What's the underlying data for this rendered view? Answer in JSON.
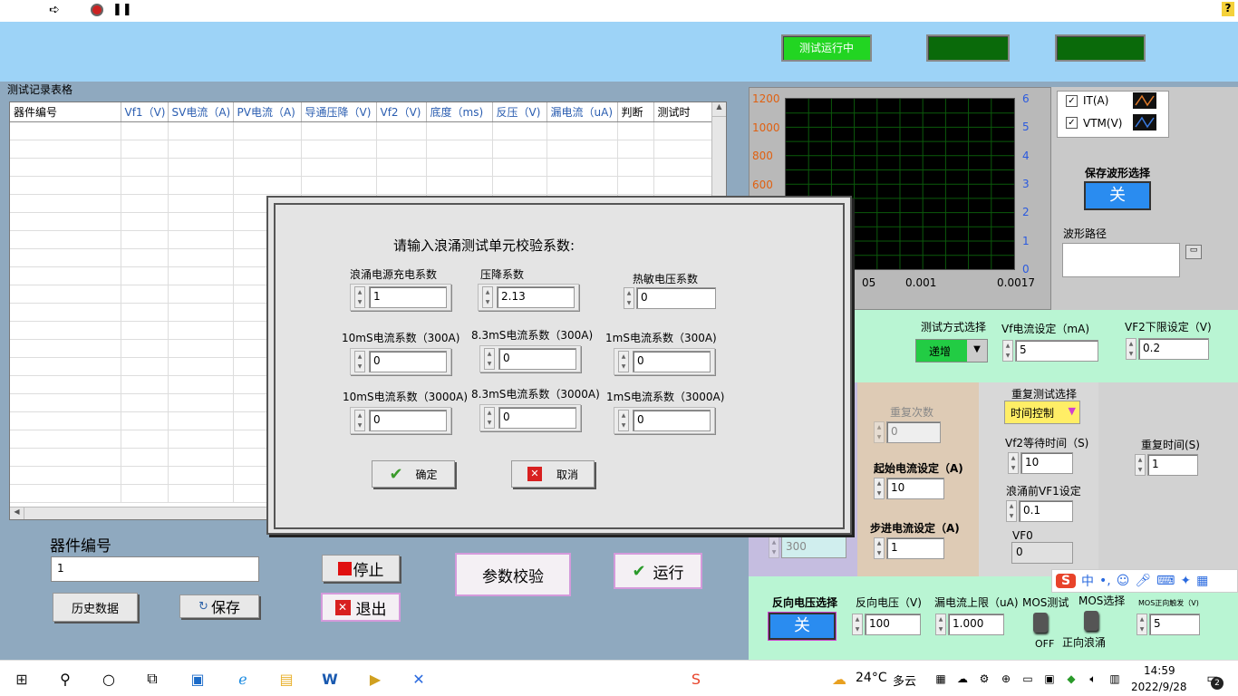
{
  "toolbar": {
    "run_icon": "run-arrow-icon",
    "abort_icon": "abort-icon",
    "pause_icon": "pause-icon",
    "help": "?"
  },
  "banner": {
    "status_indicator": "测试运行中",
    "indicator2": "",
    "indicator3": ""
  },
  "table": {
    "title": "测试记录表格",
    "columns": [
      "器件编号",
      "Vf1（V)",
      "SV电流（A)",
      "PV电流（A)",
      "导通压降（V)",
      "Vf2（V)",
      "底度（ms)",
      "反压（V)",
      "漏电流（uA)",
      "判断",
      "测试时"
    ]
  },
  "bottom_left": {
    "device_label": "器件编号",
    "device_value": "1",
    "history_button": "历史数据",
    "save_button": "保存",
    "stop_button": "停止",
    "exit_button": "退出",
    "verify_button": "参数校验",
    "run_button": "运行"
  },
  "chart": {
    "y_left_ticks": [
      "1200",
      "1000",
      "800",
      "600"
    ],
    "y_right_ticks": [
      "6",
      "5",
      "4",
      "3",
      "2",
      "1",
      "0"
    ],
    "x_ticks": [
      "05",
      "0.001",
      "0.0017"
    ]
  },
  "legend": {
    "items": [
      {
        "label": "IT(A)",
        "checked": true
      },
      {
        "label": "VTM(V)",
        "checked": true
      }
    ]
  },
  "waveform": {
    "save_label": "保存波形选择",
    "save_value": "关",
    "path_label": "波形路径",
    "path_value": ""
  },
  "mint": {
    "mode_label": "测试方式选择",
    "mode_value": "递增",
    "vf_current_label": "Vf电流设定（mA)",
    "vf_current_value": "5",
    "vf2_low_label": "VF2下限设定（V)",
    "vf2_low_value": "0.2"
  },
  "middle": {
    "repeat_count_label": "重复次数",
    "repeat_count_value": "0",
    "lav_value": "300",
    "start_current_label": "起始电流设定（A)",
    "start_current_value": "10",
    "step_current_label": "步进电流设定（A)",
    "step_current_value": "1",
    "repeat_select_label": "重复测试选择",
    "repeat_select_value": "时间控制",
    "vf2_wait_label": "Vf2等待时间（S)",
    "vf2_wait_value": "10",
    "pre_vf1_label": "浪涌前VF1设定",
    "pre_vf1_value": "0.1",
    "vf0_label": "VF0",
    "vf0_value": "0",
    "repeat_time_label": "重复时间(S)",
    "repeat_time_value": "1"
  },
  "bottom_right": {
    "rev_select_label": "反向电压选择",
    "rev_select_value": "关",
    "rev_voltage_label": "反向电压（V)",
    "rev_voltage_value": "100",
    "leak_limit_label": "漏电流上限（uA)",
    "leak_limit_value": "1.000",
    "mos_test_label": "MOS测试",
    "mos_test_state": "OFF",
    "mos_select_label": "MOS选择",
    "mos_select_state": "正向浪涌",
    "mos_trigger_label": "MOS正向触发（V)",
    "mos_trigger_value": "5"
  },
  "dialog": {
    "title": "请输入浪涌测试单元校验系数:",
    "fields": [
      {
        "label": "浪涌电源充电系数",
        "value": "1"
      },
      {
        "label": "压降系数",
        "value": "2.13"
      },
      {
        "label": "热敏电压系数",
        "value": "0"
      },
      {
        "label": "10mS电流系数（300A)",
        "value": "0"
      },
      {
        "label": "8.3mS电流系数（300A)",
        "value": "0"
      },
      {
        "label": "1mS电流系数（300A)",
        "value": "0"
      },
      {
        "label": "10mS电流系数（3000A)",
        "value": "0"
      },
      {
        "label": "8.3mS电流系数（3000A)",
        "value": "0"
      },
      {
        "label": "1mS电流系数（3000A)",
        "value": "0"
      }
    ],
    "ok_button": "确定",
    "cancel_button": "取消"
  },
  "ime": {
    "lang": "中"
  },
  "taskbar": {
    "weather_temp": "24°C",
    "weather_text": "多云",
    "time": "14:59",
    "date": "2022/9/28",
    "notifications": "2"
  }
}
